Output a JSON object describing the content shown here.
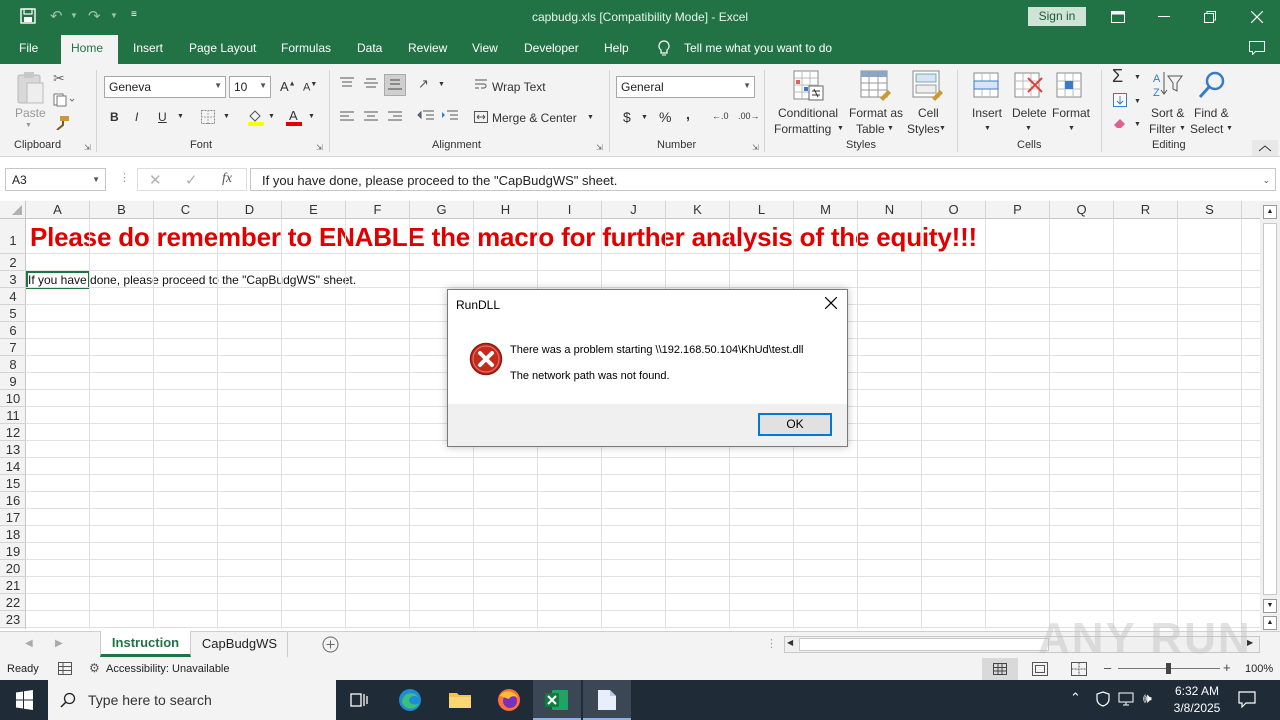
{
  "window": {
    "title": "capbudg.xls  [Compatibility Mode]  -  Excel",
    "sign_in": "Sign in"
  },
  "tabs": [
    "File",
    "Home",
    "Insert",
    "Page Layout",
    "Formulas",
    "Data",
    "Review",
    "View",
    "Developer",
    "Help"
  ],
  "tell_me": "Tell me what you want to do",
  "ribbon": {
    "clipboard": {
      "paste": "Paste",
      "label": "Clipboard"
    },
    "font": {
      "name": "Geneva",
      "size": "10",
      "bold": "B",
      "italic": "I",
      "underline": "U",
      "label": "Font"
    },
    "alignment": {
      "wrap": "Wrap Text",
      "merge": "Merge & Center",
      "label": "Alignment"
    },
    "number": {
      "format": "General",
      "currency": "$",
      "percent": "%",
      "comma": ",",
      "label": "Number"
    },
    "styles": {
      "conditional1": "Conditional",
      "conditional2": "Formatting",
      "format_table1": "Format as",
      "format_table2": "Table",
      "cell_styles1": "Cell",
      "cell_styles2": "Styles",
      "label": "Styles"
    },
    "cells": {
      "insert": "Insert",
      "delete": "Delete",
      "format": "Format",
      "label": "Cells"
    },
    "editing": {
      "sort1": "Sort &",
      "sort2": "Filter",
      "find1": "Find &",
      "find2": "Select",
      "label": "Editing"
    }
  },
  "formula_bar": {
    "name_box": "A3",
    "fx": "fx",
    "content": "If you have done, please proceed to the \"CapBudgWS\" sheet."
  },
  "columns": [
    "A",
    "B",
    "C",
    "D",
    "E",
    "F",
    "G",
    "H",
    "I",
    "J",
    "K",
    "L",
    "M",
    "N",
    "O",
    "P",
    "Q",
    "R",
    "S"
  ],
  "rows": [
    "1",
    "2",
    "3",
    "4",
    "5",
    "6",
    "7",
    "8",
    "9",
    "10",
    "11",
    "12",
    "13",
    "14",
    "15",
    "16",
    "17",
    "18",
    "19",
    "20",
    "21",
    "22",
    "23"
  ],
  "cells": {
    "a1": "Please do remember to ENABLE the macro for further analysis of the equity!!!",
    "a3": "If you have done, please proceed to the \"CapBudgWS\" sheet.",
    "a1_color": "#e00000"
  },
  "sheets": {
    "active": "Instruction",
    "other": "CapBudgWS"
  },
  "status": {
    "ready": "Ready",
    "accessibility": "Accessibility: Unavailable",
    "zoom": "100%"
  },
  "dialog": {
    "title": "RunDLL",
    "line1": "There was a problem starting \\\\192.168.50.104\\KhUd\\test.dll",
    "line2": "The network path was not found.",
    "ok": "OK"
  },
  "taskbar": {
    "search": "Type here to search",
    "time": "6:32 AM",
    "date": "3/8/2025"
  },
  "watermark": "ANY RUN",
  "colors": {
    "excel_green": "#217346",
    "error_red": "#c42b1c"
  }
}
